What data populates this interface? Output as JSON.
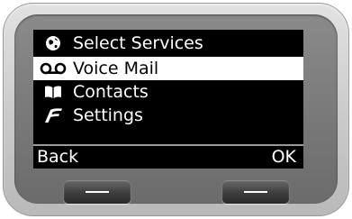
{
  "menu": {
    "items": [
      {
        "icon": "globe-services-icon",
        "label": "Select Services",
        "selected": false
      },
      {
        "icon": "voicemail-icon",
        "label": "Voice Mail",
        "selected": true
      },
      {
        "icon": "book-icon",
        "label": "Contacts",
        "selected": false
      },
      {
        "icon": "settings-icon",
        "label": "Settings",
        "selected": false
      }
    ]
  },
  "softkeys": {
    "left_label": "Back",
    "right_label": "OK"
  },
  "colors": {
    "screen_bg": "#000000",
    "screen_text": "#ffffff",
    "highlight_bg": "#ffffff",
    "highlight_text": "#000000"
  }
}
